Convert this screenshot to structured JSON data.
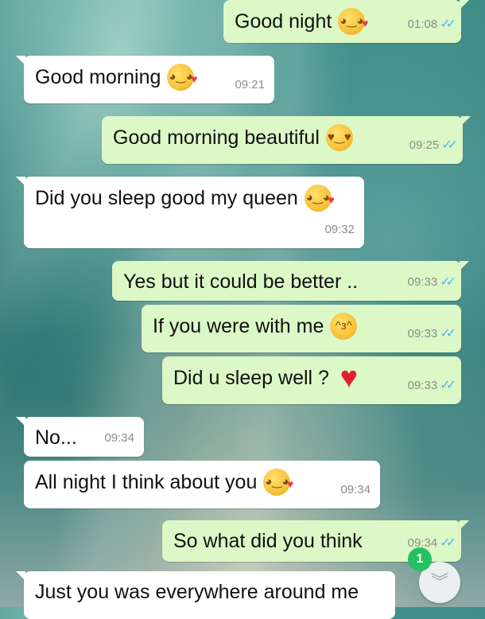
{
  "messages": [
    {
      "text": "Good night",
      "emoji": "kiss-face",
      "time": "01:08",
      "ticks": "✓✓"
    },
    {
      "text": "Good morning",
      "emoji": "kiss-face",
      "time": "09:21"
    },
    {
      "text": "Good morning beautiful",
      "emoji": "heart-eyes-face",
      "time": "09:25",
      "ticks": "✓✓"
    },
    {
      "text": "Did you sleep good my queen",
      "emoji": "kiss-face",
      "time": "09:32"
    },
    {
      "text": "Yes but it could be better ..",
      "time": "09:33",
      "ticks": "✓✓"
    },
    {
      "text": "If you were with me",
      "emoji": "kissing-closed-eyes-face",
      "time": "09:33",
      "ticks": "✓✓"
    },
    {
      "text": "Did u sleep well ?",
      "emoji": "red-heart",
      "time": "09:33",
      "ticks": "✓✓"
    },
    {
      "text": "No...",
      "time": "09:34"
    },
    {
      "text": "All night I think about you",
      "emoji": "kiss-face",
      "time": "09:34"
    },
    {
      "text": "So what did you think",
      "time": "09:34",
      "ticks": "✓✓"
    },
    {
      "text": "Just you was everywhere around me"
    }
  ],
  "scroll_button": {
    "icon": "double-chevron-down-icon",
    "glyph": "︾",
    "unread_count": "1"
  },
  "colors": {
    "outgoing": "#dcf8c6",
    "incoming": "#ffffff",
    "read_ticks": "#4fb6ec",
    "unread_badge": "#25c061"
  }
}
